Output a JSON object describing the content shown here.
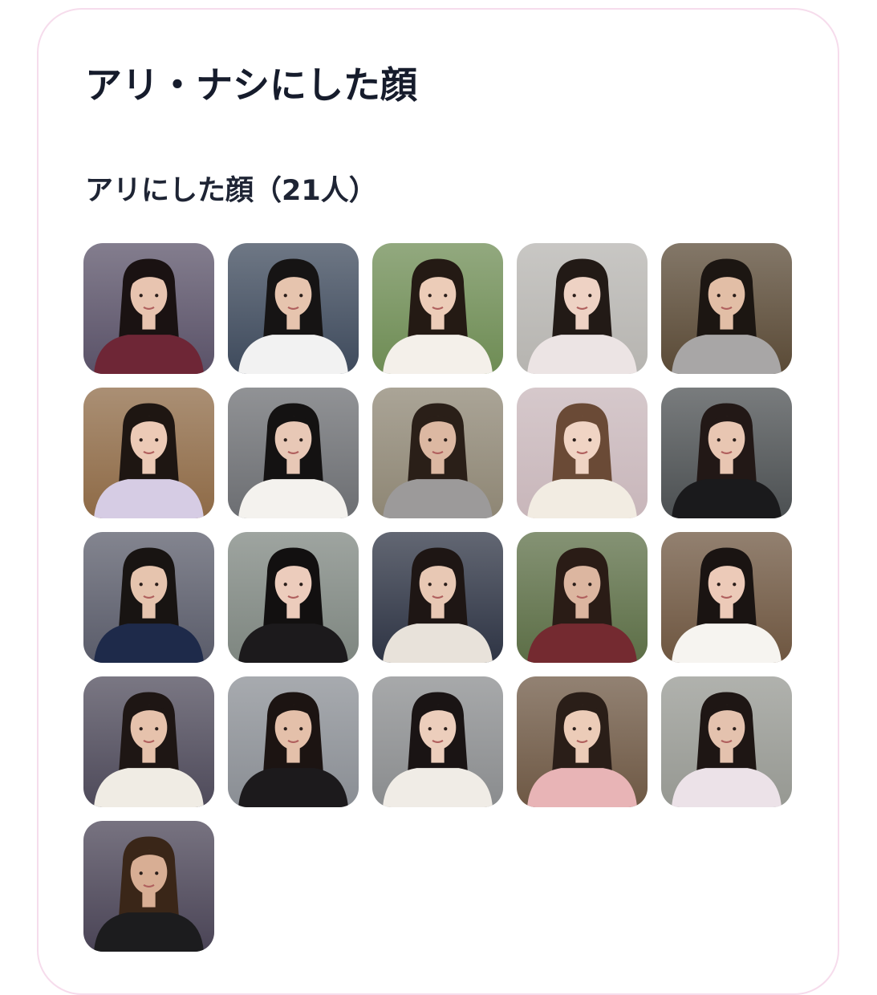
{
  "page": {
    "title": "アリ・ナシにした顔"
  },
  "section": {
    "title": "アリにした顔（21人）",
    "faces": [
      {
        "bg": "#5a5268",
        "shirt": "#6e2636",
        "hair": "#1a1212",
        "skin": "#e8c4b0"
      },
      {
        "bg": "#3e4a5c",
        "shirt": "#f2f2f2",
        "hair": "#161414",
        "skin": "#e6c4ae"
      },
      {
        "bg": "#6e8c54",
        "shirt": "#f4f0ea",
        "hair": "#241a14",
        "skin": "#ecccb8"
      },
      {
        "bg": "#b6b4b0",
        "shirt": "#ece4e4",
        "hair": "#221a16",
        "skin": "#eed2c4"
      },
      {
        "bg": "#5a4a36",
        "shirt": "#a8a6a6",
        "hair": "#1c1612",
        "skin": "#e2bea6"
      },
      {
        "bg": "#8e6a46",
        "shirt": "#d6cce4",
        "hair": "#1e1612",
        "skin": "#eccab6"
      },
      {
        "bg": "#6c6e72",
        "shirt": "#f4f2ee",
        "hair": "#141212",
        "skin": "#e8c8b6"
      },
      {
        "bg": "#8e8674",
        "shirt": "#9c9a9a",
        "hair": "#2a1f18",
        "skin": "#dcb8a2"
      },
      {
        "bg": "#c8b6ba",
        "shirt": "#f2ece2",
        "hair": "#6a4a36",
        "skin": "#f0d4c4"
      },
      {
        "bg": "#4c5052",
        "shirt": "#1a1a1c",
        "hair": "#221816",
        "skin": "#e8c6b2"
      },
      {
        "bg": "#5a5c6a",
        "shirt": "#1e2a4a",
        "hair": "#181412",
        "skin": "#e6c4ae"
      },
      {
        "bg": "#7e8680",
        "shirt": "#1c1a1c",
        "hair": "#121010",
        "skin": "#ecccbc"
      },
      {
        "bg": "#2e3444",
        "shirt": "#e8e2da",
        "hair": "#1e1614",
        "skin": "#e8c8b4"
      },
      {
        "bg": "#5c6e46",
        "shirt": "#742a30",
        "hair": "#2a1c16",
        "skin": "#dcb6a0"
      },
      {
        "bg": "#6e5640",
        "shirt": "#f6f4f0",
        "hair": "#1a1412",
        "skin": "#eccab8"
      },
      {
        "bg": "#4e4a5a",
        "shirt": "#f0ece4",
        "hair": "#1e1614",
        "skin": "#e6c2ac"
      },
      {
        "bg": "#8a8e94",
        "shirt": "#1c1a1c",
        "hair": "#1c1412",
        "skin": "#e4c0aa"
      },
      {
        "bg": "#8a8c8e",
        "shirt": "#f0ece6",
        "hair": "#1a1414",
        "skin": "#eccebc"
      },
      {
        "bg": "#6e5844",
        "shirt": "#e8b4b6",
        "hair": "#2a1e18",
        "skin": "#ecccb8"
      },
      {
        "bg": "#969892",
        "shirt": "#ece2e8",
        "hair": "#1e1614",
        "skin": "#e4c2ae"
      },
      {
        "bg": "#4a4456",
        "shirt": "#1c1c1e",
        "hair": "#3a2618",
        "skin": "#d8ae94"
      }
    ]
  }
}
